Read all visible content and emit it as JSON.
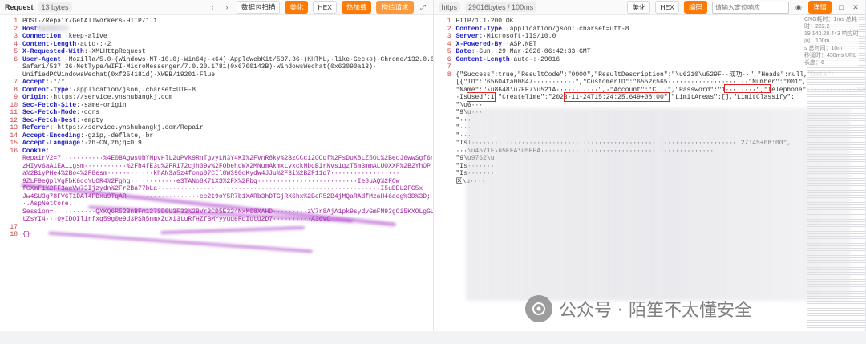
{
  "request": {
    "title": "Request",
    "size": "13 bytes",
    "buttons": {
      "scan": "数据包扫描",
      "beautify": "美化",
      "hex": "HEX",
      "hot": "热加载",
      "construct": "构造请求"
    },
    "lines": [
      {
        "n": "1",
        "parts": [
          [
            "val",
            "POST·/Repair/"
          ],
          [
            "val",
            "GetAllWorkers"
          ],
          [
            "val",
            "·HTTP/1.1"
          ]
        ]
      },
      {
        "n": "2",
        "parts": [
          [
            "key",
            "Host"
          ],
          [
            "val",
            ":·"
          ]
        ]
      },
      {
        "n": "3",
        "parts": [
          [
            "key",
            "Connection"
          ],
          [
            "val",
            ":·keep-alive"
          ]
        ]
      },
      {
        "n": "4",
        "parts": [
          [
            "key",
            "Content-Length"
          ],
          [
            "val",
            "·auto·:·2"
          ]
        ]
      },
      {
        "n": "5",
        "parts": [
          [
            "key",
            "X-Requested-With"
          ],
          [
            "val",
            ":·XMLHttpRequest"
          ]
        ]
      },
      {
        "n": "6",
        "parts": [
          [
            "key",
            "User-Agent"
          ],
          [
            "val",
            ":·Mozilla/5.0·(Windows·NT·10.0;·Win64;·x64)·AppleWebKit/537.36·(KHTML,·like·Gecko)·Chrome/132.0.0.0·"
          ]
        ]
      },
      {
        "n": "",
        "parts": [
          [
            "val",
            "Safari/537.36·NetType/WIFI·MicroMessenger/7.0.20.1781(0x6700143B)·WindowsWechat(0x63090a13)·"
          ]
        ]
      },
      {
        "n": "",
        "parts": [
          [
            "val",
            "UnifiedPCWindowsWechat(0xf254181d)·XWEB/19201·Flue"
          ]
        ]
      },
      {
        "n": "7",
        "parts": [
          [
            "key",
            "Accept"
          ],
          [
            "val",
            ":·*/*"
          ]
        ]
      },
      {
        "n": "8",
        "parts": [
          [
            "key",
            "Content-Type"
          ],
          [
            "val",
            ":·application/json;·charset=UTF-8"
          ]
        ]
      },
      {
        "n": "9",
        "parts": [
          [
            "key",
            "Origin"
          ],
          [
            "val",
            ":·https://service.ynshubangkj.com"
          ]
        ]
      },
      {
        "n": "10",
        "parts": [
          [
            "key",
            "Sec-Fetch-Site"
          ],
          [
            "val",
            ":·same-origin"
          ]
        ]
      },
      {
        "n": "11",
        "parts": [
          [
            "key",
            "Sec-Fetch-Mode"
          ],
          [
            "val",
            ":·cors"
          ]
        ]
      },
      {
        "n": "12",
        "parts": [
          [
            "key",
            "Sec-Fetch-Dest"
          ],
          [
            "val",
            ":·empty"
          ]
        ]
      },
      {
        "n": "13",
        "parts": [
          [
            "key",
            "Referer"
          ],
          [
            "val",
            ":·https://service.ynshubangkj.com/Repair"
          ]
        ]
      },
      {
        "n": "14",
        "parts": [
          [
            "key",
            "Accept-Encoding"
          ],
          [
            "val",
            ":·gzip,·deflate,·br"
          ]
        ]
      },
      {
        "n": "15",
        "parts": [
          [
            "key",
            "Accept-Language"
          ],
          [
            "val",
            ":·zh-CN,zh;q=0.9"
          ]
        ]
      },
      {
        "n": "16",
        "parts": [
          [
            "key",
            "Cookie"
          ],
          [
            "val",
            ":"
          ]
        ]
      },
      {
        "n": "",
        "parts": [
          [
            "purple",
            "RepairV2=7"
          ],
          [
            "purple",
            "···········%4E0BAgws0bYMpvHlL2uPVk9RnTgyyLN3Y4KI%2FVnR8ky%2BzCCci2OOqf%2FsDuK8LZ5OL%2BeoJ6wwSgf6nLp3eYCLc1"
          ]
        ]
      },
      {
        "n": "",
        "parts": [
          [
            "purple",
            "zHIyv6aAiEA11gsm···········%2Fh4fE3u%2FRi72cjh09v%2FObehdWX2MNumAkmxLyxckMbdBirNvs1qzT5m3mmALUOXXF%2B2YhOP"
          ]
        ]
      },
      {
        "n": "",
        "parts": [
          [
            "purple",
            "a%2BiyPHe4%2Bo4%2F8esm············khAN3a5z4fonp07CIl8W39GoKydW4JJu%2F3i%2BZF11d7··················"
          ]
        ]
      },
      {
        "n": "",
        "parts": [
          [
            "purple",
            "9ZLF9eQplVgFbK6coYUOR4%2Fghg············e3TANo8K71XS%2FX%2Fbq··························Ie8uAQ%2FOw"
          ]
        ]
      },
      {
        "n": "",
        "parts": [
          [
            "purple",
            "fCXmF1%2FF3acVw73Ijzydn%2Fr2Ba77bLa··························································I5uDEL2FG5x"
          ]
        ]
      },
      {
        "n": "",
        "parts": [
          [
            "purple",
            "Jw4SU3g78FV6T1DAl4PDxu9TqAR···················cc2t9oY5R7b1XARb3hDTGjRX6hx%2BeR52B4jMQaRAdfMzaH46aeg%3D%3D;"
          ]
        ]
      },
      {
        "n": "",
        "parts": [
          [
            "purple",
            "·.AspNetCore."
          ]
        ]
      },
      {
        "n": "",
        "parts": [
          [
            "purple",
            "Session=···········QXKQ6R52BnBFm127SD0U3F33%2BVr3CD5E324NxM08XAHD·········zV7r8AjA1pk9sydvGmFM93gCi5KXOLgGU37Ql9Ffl7Kt5CtAGe"
          ]
        ]
      },
      {
        "n": "",
        "parts": [
          [
            "purple",
            "tZsYI4···0yIDOIlirfxq59g0e9d3PSh5nmxZqXi3tuRfHZfBMYyyuqeRqIotU2D7··········A36VC"
          ]
        ]
      },
      {
        "n": "17",
        "parts": [
          [
            "val",
            ""
          ]
        ]
      },
      {
        "n": "18",
        "parts": [
          [
            "purple",
            "{}"
          ]
        ]
      }
    ]
  },
  "response": {
    "protocol": "https",
    "size": "29016bytes / 100ms",
    "buttons": {
      "beautify": "美化",
      "hex": "HEX",
      "format": "编码",
      "search_placeholder": "请输入定位响应",
      "detail": "详情"
    },
    "stats": [
      "CNG耗时：1ms  总耗时：222.2",
      "19.140.28.443  响应时间：100m",
      "s  总时间：10m",
      "秒延时：430ms  URL长度：6"
    ],
    "lines": [
      {
        "n": "1",
        "parts": [
          [
            "val",
            "HTTP/1.1·200·OK"
          ]
        ]
      },
      {
        "n": "2",
        "parts": [
          [
            "key",
            "Content-Type"
          ],
          [
            "val",
            ":·application/json;·charset=utf-8"
          ]
        ]
      },
      {
        "n": "3",
        "parts": [
          [
            "key",
            "Server"
          ],
          [
            "val",
            ":·Microsoft-IIS/10.0"
          ]
        ]
      },
      {
        "n": "4",
        "parts": [
          [
            "key",
            "X-Powered-By"
          ],
          [
            "val",
            ":·ASP.NET"
          ]
        ]
      },
      {
        "n": "5",
        "parts": [
          [
            "key",
            "Date"
          ],
          [
            "val",
            ":·Sun,·29·Mar·2026·06:42:33·GMT"
          ]
        ]
      },
      {
        "n": "6",
        "parts": [
          [
            "key",
            "Content-Length"
          ],
          [
            "val",
            "·auto·:·29016"
          ]
        ]
      },
      {
        "n": "7",
        "parts": [
          [
            "val",
            ""
          ]
        ]
      },
      {
        "n": "8",
        "parts": [
          [
            "val",
            "{\"Success\":true,\"ResultCode\":\"0000\",\"ResultDescription\":\"\\u6210\\u529F··成功··\",\"Heads\":null,\"Data\":"
          ]
        ]
      },
      {
        "n": "",
        "parts": [
          [
            "val",
            "[{\"ID\":\"65604fa00847···········\",\"CustomerID\":\"6552c565·····················\"Number\":\"001\","
          ]
        ]
      },
      {
        "n": "",
        "parts": [
          [
            "val",
            "\"Name\":\"\\u8648\\u7EE7\\u521A···········\",·\"Account\":\"C···\",\"Password\":\"1········\",\"Telephone\":\"···········329\","
          ]
        ]
      },
      {
        "n": "",
        "parts": [
          [
            "val",
            "·IsUsed\":1,\"CreateTime\":\"2023-11-24T15:24:25.649+08:00\",\"LimitAreas\":[],\"LimitClassify\":"
          ]
        ]
      },
      {
        "n": "",
        "parts": [
          [
            "val",
            "\"\\u6···"
          ]
        ]
      },
      {
        "n": "",
        "parts": [
          [
            "val",
            "\"9\\u···"
          ]
        ]
      },
      {
        "n": "",
        "parts": [
          [
            "val",
            "\"···"
          ]
        ]
      },
      {
        "n": "",
        "parts": [
          [
            "val",
            "\"···"
          ]
        ]
      },
      {
        "n": "",
        "parts": [
          [
            "val",
            "\"···"
          ]
        ]
      },
      {
        "n": "",
        "parts": [
          [
            "val",
            "\"Tsl·····································································:27:45+08:00\","
          ]
        ]
      },
      {
        "n": "",
        "parts": [
          [
            "val",
            "···\\u4571F\\u5EFA\\u5EFA·············································"
          ]
        ]
      },
      {
        "n": "",
        "parts": [
          [
            "val",
            "\"9\\u9762\\u"
          ]
        ]
      },
      {
        "n": "",
        "parts": [
          [
            "val",
            "\"Is·······"
          ]
        ]
      },
      {
        "n": "",
        "parts": [
          [
            "val",
            "\"Is·······"
          ]
        ]
      },
      {
        "n": "",
        "parts": [
          [
            "val",
            "区\\u····"
          ]
        ]
      }
    ]
  },
  "watermark": {
    "text": "公众号 · 陌笙不太懂安全"
  },
  "colors": {
    "accent": "#ff7a00",
    "key": "#1f1fbf",
    "purple": "#a020a0",
    "highlight": "#e02020"
  }
}
